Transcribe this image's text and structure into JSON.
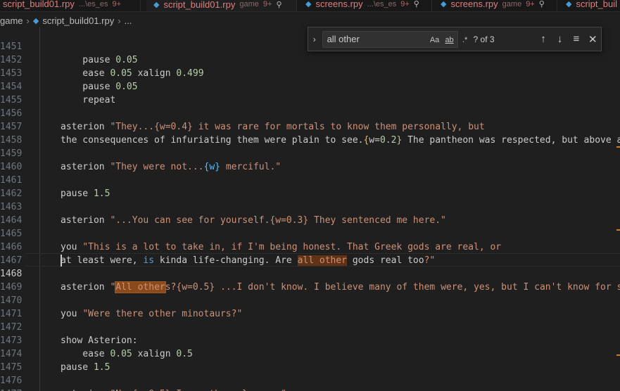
{
  "tabs": [
    {
      "name": "script_build01.rpy",
      "desc": "...\\es_es",
      "badge": "9+",
      "active": false
    },
    {
      "name": "script_build01.rpy",
      "desc": "game",
      "badge": "9+",
      "active": true
    },
    {
      "name": "screens.rpy",
      "desc": "...\\es_es",
      "badge": "9+",
      "active": false
    },
    {
      "name": "screens.rpy",
      "desc": "game",
      "badge": "9+",
      "active": false
    },
    {
      "name": "script_buil",
      "desc": "",
      "badge": "",
      "active": false
    }
  ],
  "breadcrumb": {
    "folder": "game",
    "file": "script_build01.rpy",
    "more": "..."
  },
  "find": {
    "query": "all other",
    "match_case": "Aa",
    "whole_word": "ab",
    "regex": ".*",
    "count": "? of 3"
  },
  "editor": {
    "current_line": "1468",
    "lines": [
      {
        "n": "1451",
        "t": "        pause 0.05"
      },
      {
        "n": "1452",
        "t": "        ease 0.05 xalign 0.499"
      },
      {
        "n": "1453",
        "t": "        pause 0.05"
      },
      {
        "n": "1454",
        "t": "        repeat"
      },
      {
        "n": "1455",
        "t": ""
      },
      {
        "n": "1456",
        "t": "    asterion \"They...{w=0.4} it was rare for mortals to know them personally, but"
      },
      {
        "n": "1457",
        "t": "    the consequences of infuriating them were plain to see.{w=0.2} The pantheon was respected, but above a"
      },
      {
        "n": "1458",
        "t": ""
      },
      {
        "n": "1459",
        "t": "    asterion \"They were not...{w} merciful.\""
      },
      {
        "n": "1460",
        "t": ""
      },
      {
        "n": "1461",
        "t": "    pause 1.5"
      },
      {
        "n": "1462",
        "t": ""
      },
      {
        "n": "1463",
        "t": "    asterion \"...You can see for yourself.{w=0.3} They sentenced me here.\""
      },
      {
        "n": "1464",
        "t": ""
      },
      {
        "n": "1465",
        "t": "    you \"This is a lot to take in, if I'm being honest. That Greek gods are real, or"
      },
      {
        "n": "1466",
        "t": "    at least were, is kinda life-changing. Are all other gods real too?\""
      },
      {
        "n": "1467",
        "t": ""
      },
      {
        "n": "1468",
        "t": "    asterion \"All others?{w=0.5} ...I don't know. I believe many of them were, yes, but I can't know for s"
      },
      {
        "n": "1469",
        "t": ""
      },
      {
        "n": "1470",
        "t": "    you \"Were there other minotaurs?\""
      },
      {
        "n": "1471",
        "t": ""
      },
      {
        "n": "1472",
        "t": "    show Asterion:"
      },
      {
        "n": "1473",
        "t": "        ease 0.05 xalign 0.5"
      },
      {
        "n": "1474",
        "t": "    pause 1.5"
      },
      {
        "n": "1475",
        "t": ""
      },
      {
        "n": "1476",
        "t": "    asterion \"No.{w=0.5} I was the only one.\""
      },
      {
        "n": "1477",
        "t": ""
      }
    ]
  }
}
